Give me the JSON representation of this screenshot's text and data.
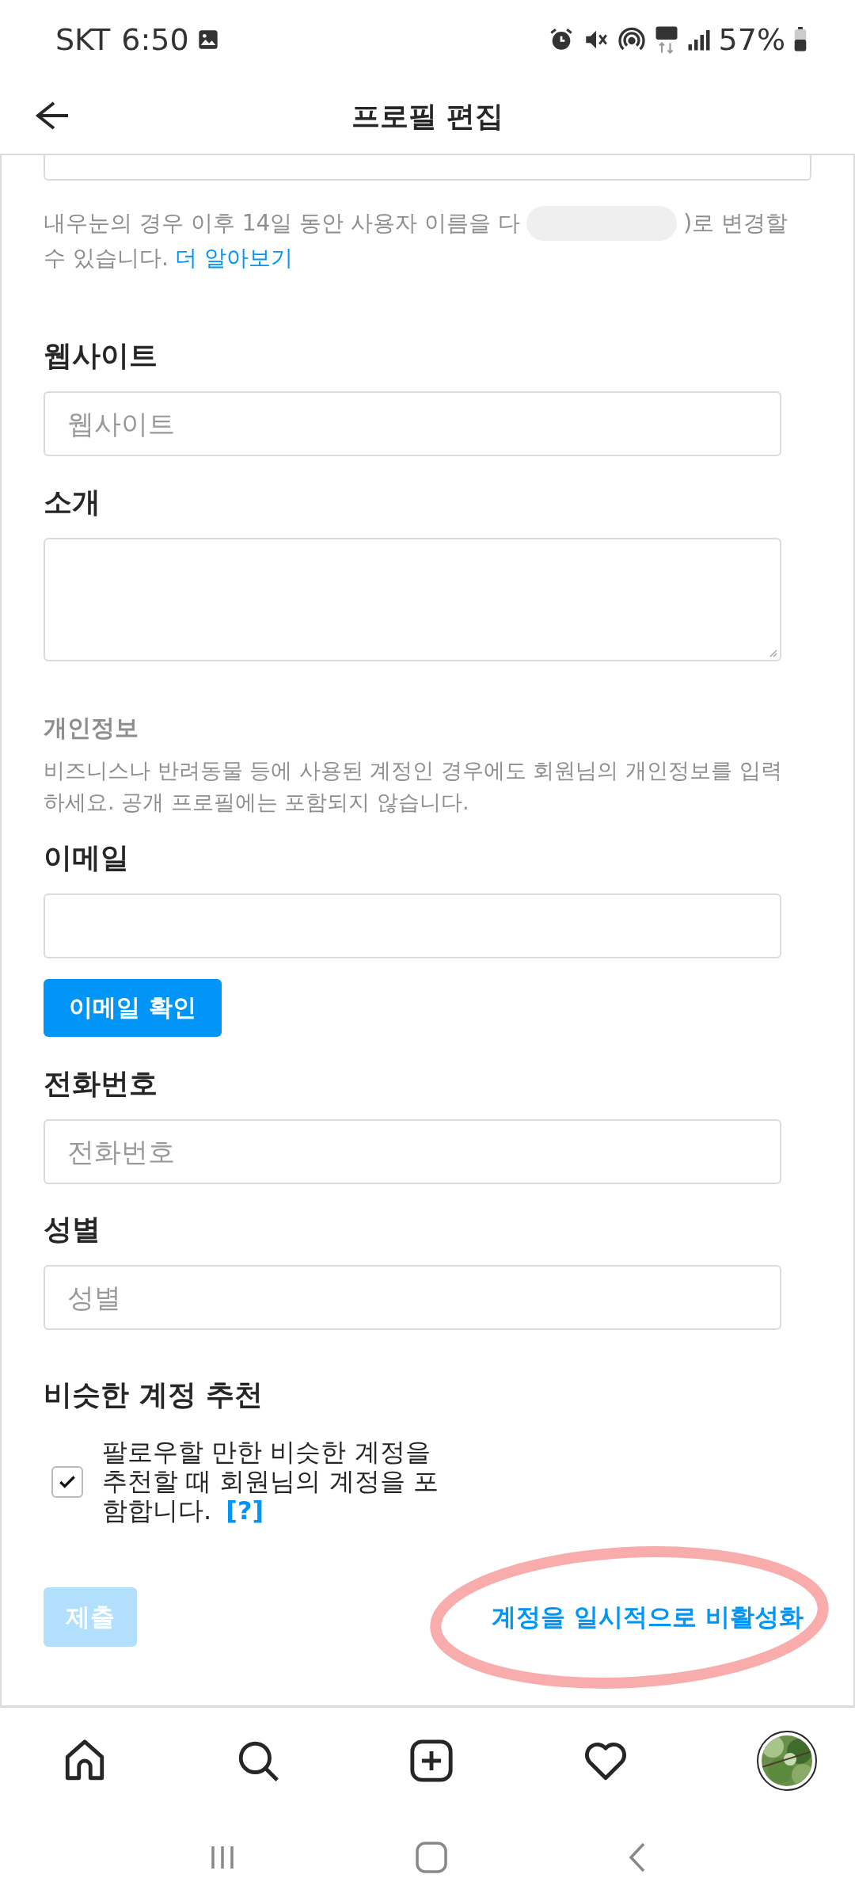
{
  "status_bar": {
    "carrier": "SKT",
    "time": "6:50",
    "battery": "57%"
  },
  "header": {
    "title": "프로필 편집"
  },
  "username_hint": {
    "text_before": "내우눈의 경우 이후 14일 동안 사용자 이름을 다",
    "text_after": ")로 변경할",
    "text_line_2": "수 있습니다.",
    "link": "더 알아보기"
  },
  "website": {
    "label": "웹사이트",
    "placeholder": "웹사이트"
  },
  "bio": {
    "label": "소개"
  },
  "private_info": {
    "heading": "개인정보",
    "description": "비즈니스나 반려동물 등에 사용된 계정인 경우에도 회원님의 개인정보를 입력하세요. 공개 프로필에는 포함되지 않습니다."
  },
  "email": {
    "label": "이메일",
    "verify_button": "이메일 확인"
  },
  "phone": {
    "label": "전화번호",
    "placeholder": "전화번호"
  },
  "gender": {
    "label": "성별",
    "placeholder": "성별"
  },
  "similar_accounts": {
    "heading": "비슷한 계정 추천",
    "checked": true,
    "text": "팔로우할 만한 비슷한 계정을 추천할 때 회원님의 계정을 포함합니다.",
    "help_link": "[?]"
  },
  "submit": {
    "label": "제출",
    "disabled": true
  },
  "deactivate_link": "계정을 일시적으로 비활성화",
  "bottom_nav": [
    {
      "kind": "home"
    },
    {
      "kind": "search"
    },
    {
      "kind": "add"
    },
    {
      "kind": "heart"
    },
    {
      "kind": "profile"
    }
  ]
}
